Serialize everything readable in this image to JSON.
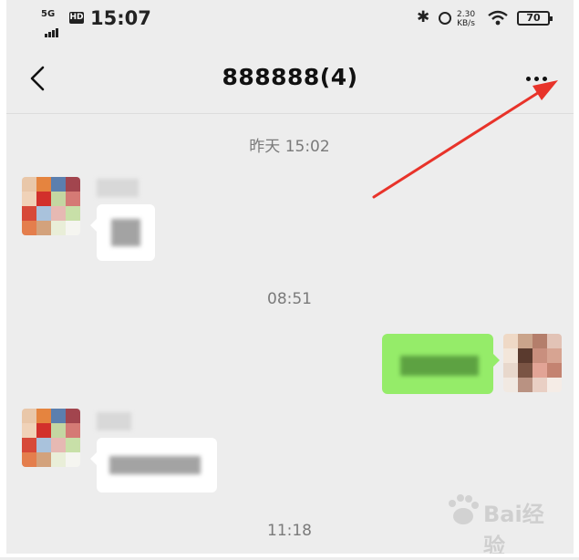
{
  "status_bar": {
    "network": "5G",
    "hd": "HD",
    "time": "15:07",
    "bluetooth_icon": "bluetooth-icon",
    "speed_value": "2.30",
    "speed_unit": "KB/s",
    "battery": "70"
  },
  "header": {
    "title": "888888(4)",
    "back_icon": "chevron-left-icon",
    "more_icon": "more-dots-icon"
  },
  "messages": {
    "ts1": "昨天 15:02",
    "ts2": "08:51",
    "ts3": "11:18"
  },
  "watermark": {
    "text": "Bai经验",
    "icon": "paw-icon"
  },
  "colors": {
    "background": "#ededed",
    "bubble_out": "#95ec69",
    "bubble_in": "#ffffff",
    "arrow": "#e8332a"
  }
}
